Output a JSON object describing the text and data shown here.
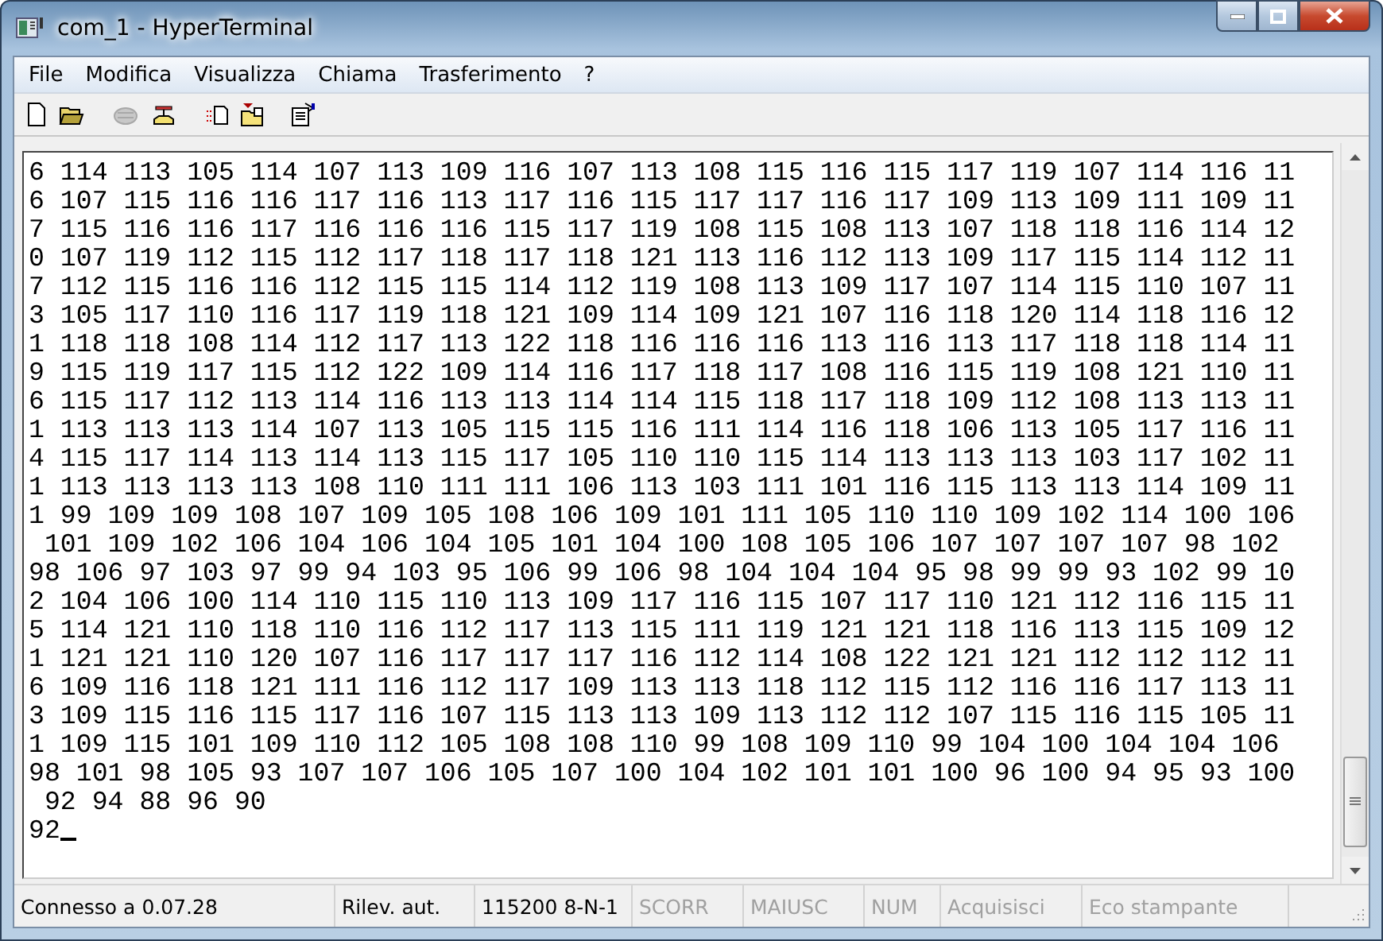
{
  "window": {
    "title": "com_1 - HyperTerminal"
  },
  "menu": [
    "File",
    "Modifica",
    "Visualizza",
    "Chiama",
    "Trasferimento",
    "?"
  ],
  "toolbar": [
    {
      "kind": "new",
      "disabled": false
    },
    {
      "kind": "open",
      "disabled": false
    },
    {
      "kind": "disconnect",
      "disabled": true
    },
    {
      "kind": "call",
      "disabled": false
    },
    {
      "kind": "send",
      "disabled": false
    },
    {
      "kind": "receive",
      "disabled": false
    },
    {
      "kind": "properties",
      "disabled": false
    }
  ],
  "terminal": {
    "lines": [
      "6 114 113 105 114 107 113 109 116 107 113 108 115 116 115 117 119 107 114 116 11",
      "6 107 115 116 116 117 116 113 117 116 115 117 117 116 117 109 113 109 111 109 11",
      "7 115 116 116 117 116 116 116 115 117 119 108 115 108 113 107 118 118 116 114 12",
      "0 107 119 112 115 112 117 118 117 118 121 113 116 112 113 109 117 115 114 112 11",
      "7 112 115 116 116 112 115 115 114 112 119 108 113 109 117 107 114 115 110 107 11",
      "3 105 117 110 116 117 119 118 121 109 114 109 121 107 116 118 120 114 118 116 12",
      "1 118 118 108 114 112 117 113 122 118 116 116 116 113 116 113 117 118 118 114 11",
      "9 115 119 117 115 112 122 109 114 116 117 118 117 108 116 115 119 108 121 110 11",
      "6 115 117 112 113 114 116 113 113 114 114 115 118 117 118 109 112 108 113 113 11",
      "1 113 113 113 114 107 113 105 115 115 116 111 114 116 118 106 113 105 117 116 11",
      "4 115 117 114 113 114 113 115 117 105 110 110 115 114 113 113 113 103 117 102 11",
      "1 113 113 113 113 108 110 111 111 106 113 103 111 101 116 115 113 113 114 109 11",
      "1 99 109 109 108 107 109 105 108 106 109 101 111 105 110 110 109 102 114 100 106",
      " 101 109 102 106 104 106 104 105 101 104 100 108 105 106 107 107 107 107 98 102",
      "98 106 97 103 97 99 94 103 95 106 99 106 98 104 104 104 95 98 99 99 93 102 99 10",
      "2 104 106 100 114 110 115 110 113 109 117 116 115 107 117 110 121 112 116 115 11",
      "5 114 121 110 118 110 116 112 117 113 115 111 119 121 121 118 116 113 115 109 12",
      "1 121 121 110 120 107 116 117 117 117 116 112 114 108 122 121 121 112 112 112 11",
      "6 109 116 118 121 111 116 112 117 109 113 113 118 112 115 112 116 116 117 113 11",
      "3 109 115 116 115 117 116 107 115 113 113 109 113 112 112 107 115 116 115 105 11",
      "1 109 115 101 109 110 112 105 108 108 110 99 108 109 110 99 104 100 104 104 106",
      "98 101 98 105 93 107 107 106 105 107 100 104 102 101 101 100 96 100 94 95 93 100",
      " 92 94 88 96 90",
      "92"
    ]
  },
  "status_bar": [
    {
      "text": "Connesso a 0.07.28",
      "disabled": false
    },
    {
      "text": "Rilev. aut.",
      "disabled": false
    },
    {
      "text": "115200 8-N-1",
      "disabled": false
    },
    {
      "text": "SCORR",
      "disabled": true
    },
    {
      "text": "MAIUSC",
      "disabled": true
    },
    {
      "text": "NUM",
      "disabled": true
    },
    {
      "text": "Acquisisci",
      "disabled": true
    },
    {
      "text": "Eco stampante",
      "disabled": true
    }
  ]
}
